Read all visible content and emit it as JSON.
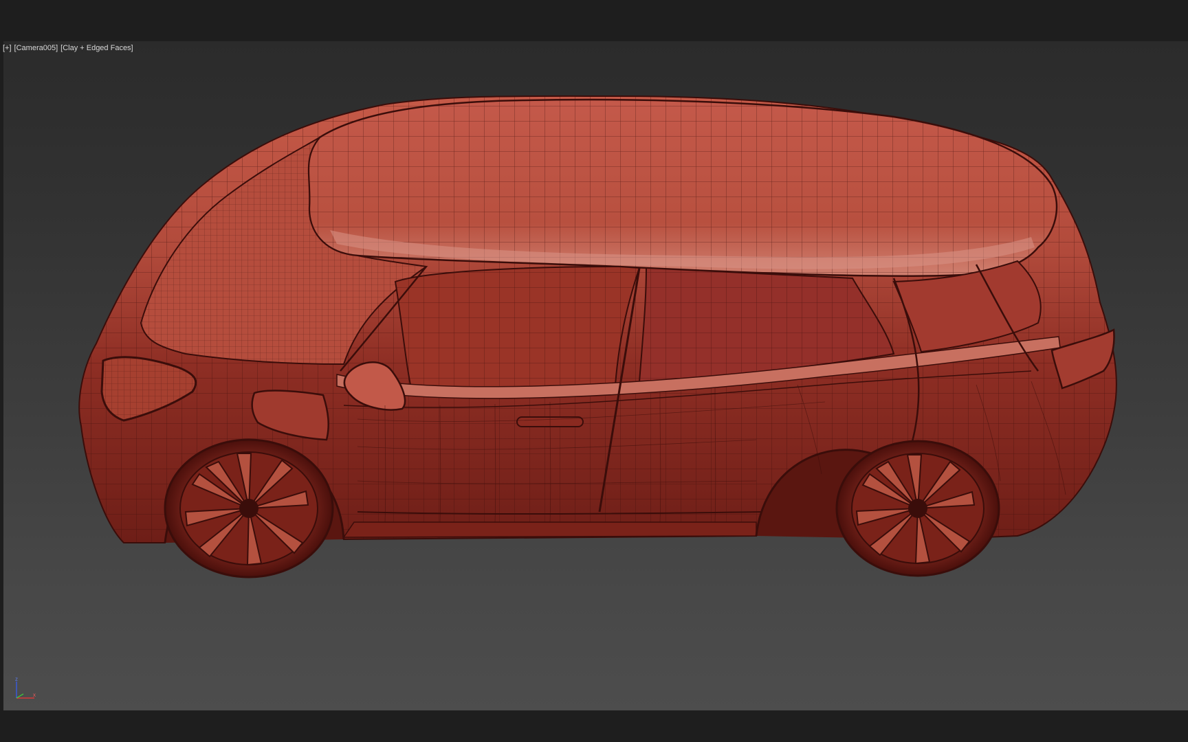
{
  "viewport": {
    "menu_plus": "[+]",
    "camera": "[Camera005]",
    "shading": "[Clay + Edged Faces]"
  },
  "axis": {
    "z_label": "z",
    "x_label": "x"
  },
  "colors": {
    "body": "#9c3a2e",
    "body_highlight": "#c86353",
    "body_shadow": "#6a1c16",
    "wire": "#3a0d0a",
    "bg_top": "#2b2b2b",
    "bg_bottom": "#4d4d4d"
  }
}
